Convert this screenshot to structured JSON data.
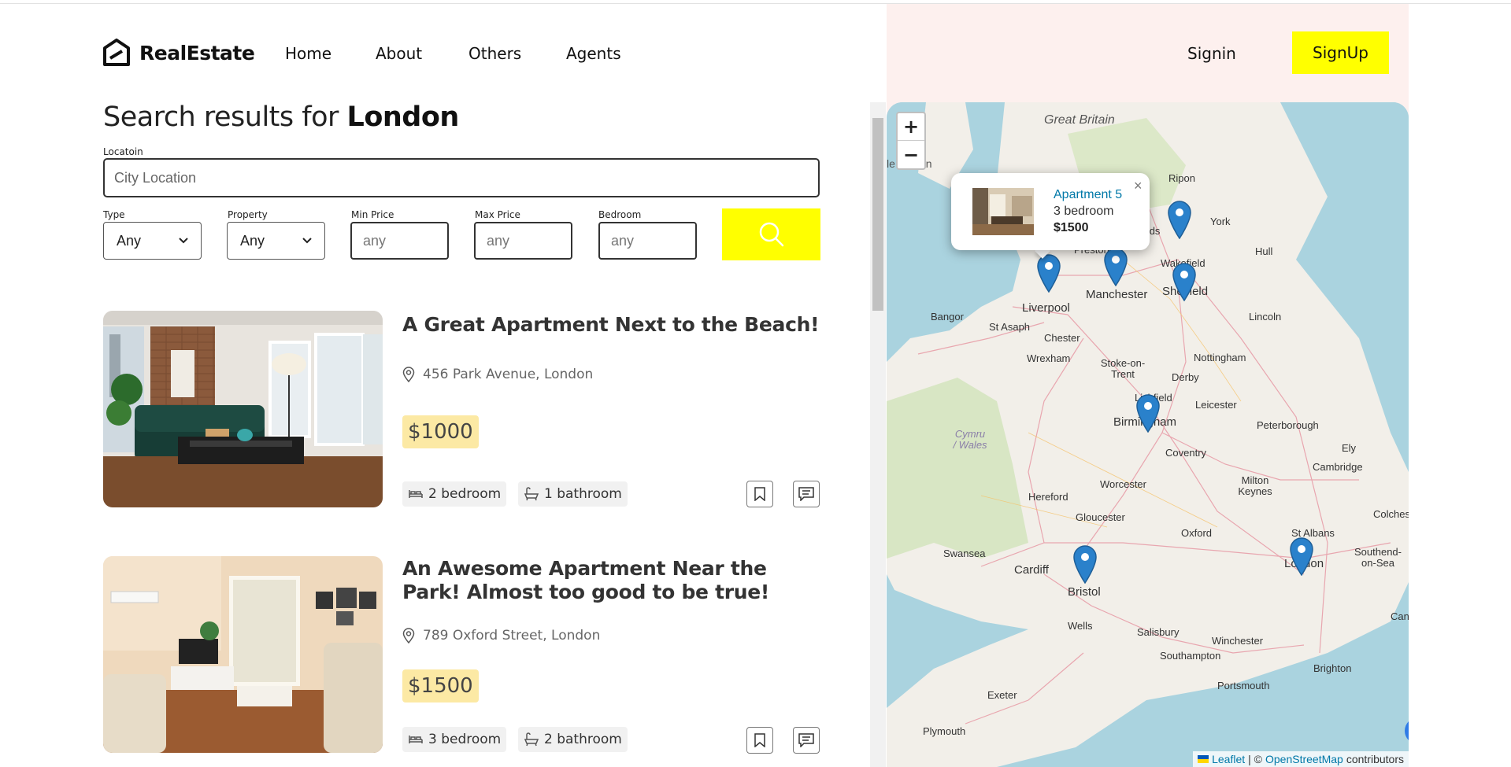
{
  "brand": {
    "name": "RealEstate"
  },
  "nav": {
    "items": [
      "Home",
      "About",
      "Others",
      "Agents"
    ],
    "signin": "Signin",
    "signup": "SignUp"
  },
  "search": {
    "heading_prefix": "Search results for",
    "heading_city": "London",
    "location_label": "Locatoin",
    "location_placeholder": "City Location",
    "type_label": "Type",
    "type_value": "Any",
    "property_label": "Property",
    "property_value": "Any",
    "min_price_label": "Min Price",
    "min_price_placeholder": "any",
    "max_price_label": "Max Price",
    "max_price_placeholder": "any",
    "bedroom_label": "Bedroom",
    "bedroom_placeholder": "any"
  },
  "listings": [
    {
      "title": "A Great Apartment Next to the Beach!",
      "address": "456 Park Avenue, London",
      "price": "$1000",
      "bedrooms": "2 bedroom",
      "bathrooms": "1 bathroom"
    },
    {
      "title": "An Awesome Apartment Near the Park! Almost too good to be true!",
      "address": "789 Oxford Street, London",
      "price": "$1500",
      "bedrooms": "3 bedroom",
      "bathrooms": "2 bathroom"
    }
  ],
  "map": {
    "zoom_in": "+",
    "zoom_out": "−",
    "popup": {
      "title": "Apartment 5",
      "subtitle": "3 bedroom",
      "price": "$1500",
      "close": "×"
    },
    "labels": [
      "Great Britain",
      "le of Man",
      "Ripon",
      "York",
      "Leeds",
      "Preston",
      "Hull",
      "Wakefield",
      "Liverpool",
      "Manchester",
      "Sheffield",
      "Bangor",
      "St Asaph",
      "Chester",
      "Lincoln",
      "Wrexham",
      "Stoke-on-Trent",
      "Nottingham",
      "Derby",
      "Lichfield",
      "Leicester",
      "Birmingham",
      "Peterborough",
      "Cymru / Wales",
      "Coventry",
      "Ely",
      "Cambridge",
      "Worcester",
      "Hereford",
      "Milton Keynes",
      "Gloucester",
      "Colches",
      "Oxford",
      "St Albans",
      "Swansea",
      "Cardiff",
      "London",
      "Southend-on-Sea",
      "Bristol",
      "Wells",
      "Salisbury",
      "Winchester",
      "Cant",
      "Southampton",
      "Brighton",
      "Portsmouth",
      "Exeter",
      "Plymouth"
    ],
    "attribution": {
      "leaflet": "Leaflet",
      "sep": "| ©",
      "osm": "OpenStreetMap",
      "suffix": "contributors"
    }
  }
}
